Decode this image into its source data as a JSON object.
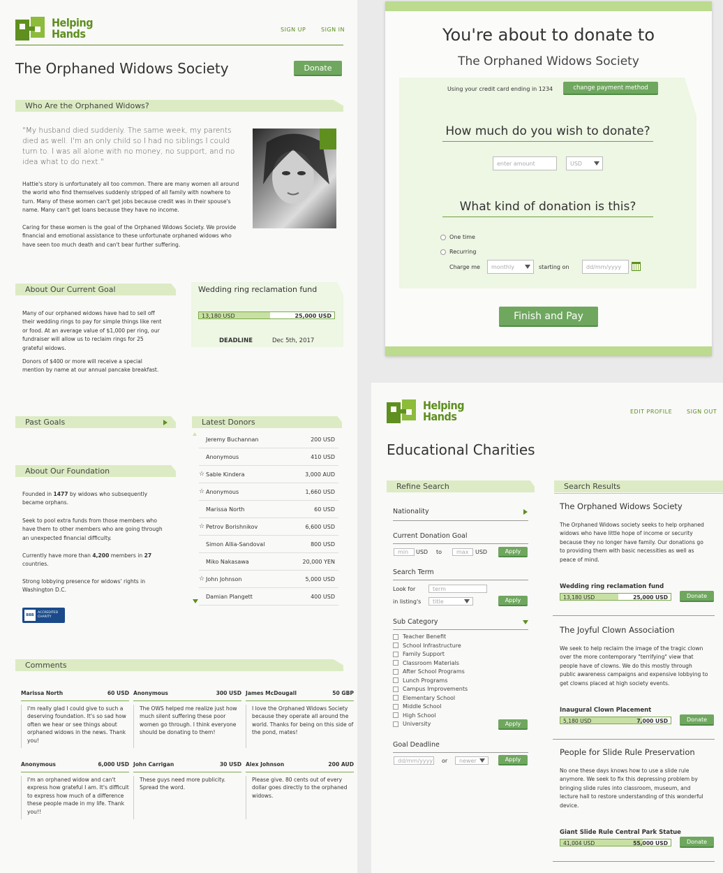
{
  "brand": {
    "name_line1": "Helping",
    "name_line2": "Hands",
    "color": "#5e8f1f"
  },
  "p1": {
    "nav": {
      "signup": "SIGN UP",
      "signin": "SIGN IN"
    },
    "title": "The Orphaned Widows Society",
    "donate": "Donate",
    "who_head": "Who Are the Orphaned Widows?",
    "quote": "\"My husband died suddenly. The same week, my parents died as well. I'm an only child so I had no siblings I could turn to. I was all alone with no money, no support, and no idea what to do next.\"",
    "para1": "Hattie's story is unfortunately all too common. There are many women all around the world who find themselves suddenly stripped of all family with nowhere to turn. Many of these women can't get jobs because credit was in their spouse's name. Many can't get loans because they have no income.",
    "para2": "Caring for these women is the goal of the Orphaned Widows Society. We provide financial and emotional assistance to these unfortunate orphaned widows who have seen too much death and can't bear further suffering.",
    "goal_head": "About Our Current Goal",
    "goal_p1": "Many of our orphaned widows have had to sell off their wedding rings to pay for simple things like rent or food. At an average value of $1,000 per ring, our fundraiser will allow us to reclaim rings for 25 grateful widows.",
    "goal_p2": "Donors of $400 or more will receive a special mention by name at our annual pancake breakfast.",
    "fund_title": "Wedding ring reclamation fund",
    "fund_raised": "13,180 USD",
    "fund_goal": "25,000 USD",
    "fund_progress": 0.527,
    "deadline_label": "DEADLINE",
    "deadline_value": "Dec 5th, 2017",
    "past_head": "Past Goals",
    "donors_head": "Latest Donors",
    "donors": [
      {
        "name": "Jeremy Buchannan",
        "amount": "200 USD",
        "star": false
      },
      {
        "name": "Anonymous",
        "amount": "410 USD",
        "star": false
      },
      {
        "name": "Sable Kindera",
        "amount": "3,000 AUD",
        "star": true
      },
      {
        "name": "Anonymous",
        "amount": "1,660 USD",
        "star": true
      },
      {
        "name": "Marissa North",
        "amount": "60 USD",
        "star": false
      },
      {
        "name": "Petrov Borishnikov",
        "amount": "6,600 USD",
        "star": true
      },
      {
        "name": "Simon Allia-Sandoval",
        "amount": "800 USD",
        "star": false
      },
      {
        "name": "Miko Nakasawa",
        "amount": "20,000 YEN",
        "star": false
      },
      {
        "name": "John Johnson",
        "amount": "5,000 USD",
        "star": true
      },
      {
        "name": "Damian Plangett",
        "amount": "400 USD",
        "star": false
      }
    ],
    "found_head": "About Our Foundation",
    "found_p1_a": "Founded in ",
    "found_p1_b": "1477",
    "found_p1_c": " by widows who subsequently became orphans.",
    "found_p2": "Seek to pool extra funds from those members who have them to other members who are going through an unexpected financial difficulty.",
    "found_p3_a": "Currently have more than ",
    "found_p3_b": "4,200",
    "found_p3_c": " members in ",
    "found_p3_d": "27",
    "found_p3_e": " countries.",
    "found_p4": "Strong lobbying presence for widows' rights in Washington D.C.",
    "badge_line1": "ACCREDITED",
    "badge_line2": "CHARITY",
    "badge_logo": "BBB",
    "comments_head": "Comments",
    "comments": [
      {
        "name": "Marissa North",
        "amount": "60 USD",
        "text": "I'm really glad I could give to such a deserving foundation. It's so sad how often we hear or see things about orphaned widows in the news. Thank you!"
      },
      {
        "name": "Anonymous",
        "amount": "300 USD",
        "text": "The OWS helped me realize just how much silent suffering these poor women go through. I think everyone should be donating to them!"
      },
      {
        "name": "James McDougall",
        "amount": "50 GBP",
        "text": "I love the Orphaned Widows Society because they operate all around the world. Thanks for being on this side of the pond, mates!"
      },
      {
        "name": "Anonymous",
        "amount": "6,000 USD",
        "text": "I'm an orphaned widow and can't express how grateful I am. It's difficult to express how much of a difference these people made in my life. Thank you!!"
      },
      {
        "name": "John Carrigan",
        "amount": "30 USD",
        "text": "These guys need more publicity. Spread the word."
      },
      {
        "name": "Alex Johnson",
        "amount": "200 AUD",
        "text": "Please give. 80 cents out of every dollar goes directly to the orphaned widows."
      }
    ]
  },
  "p2": {
    "heading": "You're about to donate to",
    "org": "The Orphaned Widows Society",
    "card_text": "Using your credit card ending in 1234",
    "change_btn": "change payment method",
    "q1": "How much do you wish to donate?",
    "amount_placeholder": "enter amount",
    "currency": "USD",
    "q2": "What kind of donation is this?",
    "one_time": "One time",
    "recurring": "Recurring",
    "charge_me": "Charge me",
    "freq": "monthly",
    "starting_on": "starting on",
    "date_placeholder": "dd/mm/yyyy",
    "finish": "Finish and Pay"
  },
  "p3": {
    "nav": {
      "edit": "EDIT PROFILE",
      "signout": "SIGN OUT"
    },
    "title": "Educational Charities",
    "refine_head": "Refine Search",
    "results_head": "Search Results",
    "nationality": "Nationality",
    "goal_label": "Current Donation Goal",
    "min": "min",
    "max": "max",
    "usd": "USD",
    "to": "to",
    "apply": "Apply",
    "term_head": "Search Term",
    "look_for": "Look for",
    "term_ph": "term",
    "in_listing": "in listing's",
    "title_opt": "title",
    "subcat": "Sub Category",
    "categories": [
      "Teacher Benefit",
      "School Infrastructure",
      "Family Support",
      "Classroom Materials",
      "After School Programs",
      "Lunch Programs",
      "Campus Improvements",
      "Elementary School",
      "Middle School",
      "High School",
      "University"
    ],
    "deadline_head": "Goal Deadline",
    "date_ph": "dd/mm/yyyy",
    "or": "or",
    "newer": "newer",
    "results": [
      {
        "name": "The Orphaned Widows Society",
        "desc": "The Orphaned Widows society seeks to help orphaned widows who have little hope of income or security because they no longer have family. Our donations go to providing them with basic necessities as well as peace of mind.",
        "fund": "Wedding ring reclamation fund",
        "raised": "13,180 USD",
        "goal": "25,000 USD",
        "progress": 0.527
      },
      {
        "name": "The Joyful Clown Association",
        "desc": "We seek to help reclaim the image of the tragic clown over the more contemporary \"terrifying\" view that people have of clowns. We do this mostly through public awareness campaigns and expensive lobbying to get clowns placed at high society events.",
        "fund": "Inaugural Clown Placement",
        "raised": "5,180 USD",
        "goal": "7,000 USD",
        "progress": 0.74
      },
      {
        "name": "People for Slide Rule Preservation",
        "desc": "No one these days knows how to use a slide rule anymore. We seek to fix this depressing problem by bringing slide rules into classroom, museum, and lecture hall to restore understanding of this wonderful device.",
        "fund": "Giant Slide Rule Central Park Statue",
        "raised": "41,004 USD",
        "goal": "55,000 USD",
        "progress": 0.746
      }
    ],
    "donate": "Donate"
  }
}
